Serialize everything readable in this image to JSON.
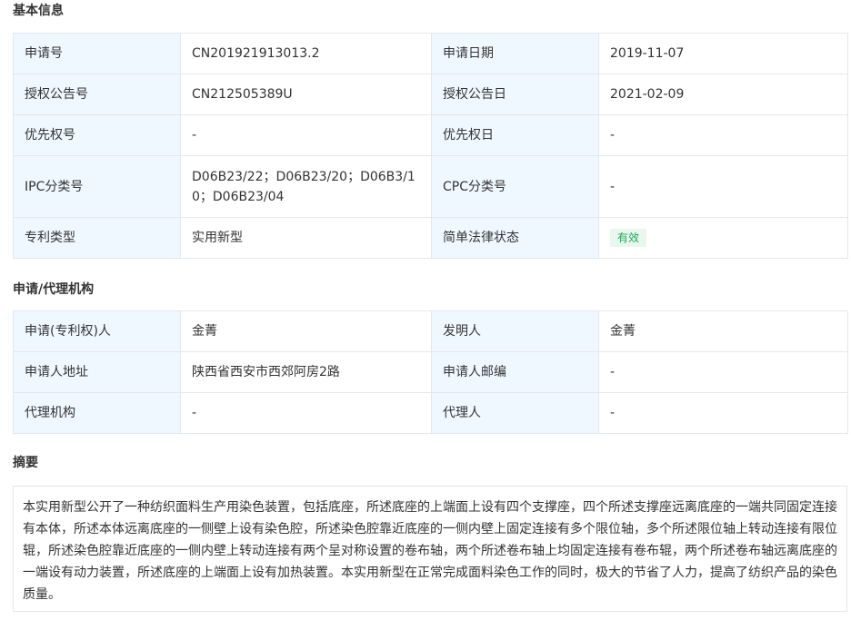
{
  "sections": {
    "basic_title": "基本信息",
    "agency_title": "申请/代理机构",
    "abstract_title": "摘要"
  },
  "basic": [
    {
      "l1": "申请号",
      "v1": "CN201921913013.2",
      "l2": "申请日期",
      "v2": "2019-11-07"
    },
    {
      "l1": "授权公告号",
      "v1": "CN212505389U",
      "l2": "授权公告日",
      "v2": "2021-02-09"
    },
    {
      "l1": "优先权号",
      "v1": "-",
      "l2": "优先权日",
      "v2": "-"
    },
    {
      "l1": "IPC分类号",
      "v1": "D06B23/22；D06B23/20；D06B3/10；D06B23/04",
      "l2": "CPC分类号",
      "v2": "-"
    },
    {
      "l1": "专利类型",
      "v1": "实用新型",
      "l2": "简单法律状态",
      "v2": "有效"
    }
  ],
  "agency": [
    {
      "l1": "申请(专利权)人",
      "v1": "金菁",
      "l2": "发明人",
      "v2": "金菁"
    },
    {
      "l1": "申请人地址",
      "v1": "陕西省西安市西郊阿房2路",
      "l2": "申请人邮编",
      "v2": "-"
    },
    {
      "l1": "代理机构",
      "v1": "-",
      "l2": "代理人",
      "v2": "-"
    }
  ],
  "abstract": "本实用新型公开了一种纺织面料生产用染色装置，包括底座，所述底座的上端面上设有四个支撑座，四个所述支撑座远离底座的一端共同固定连接有本体，所述本体远离底座的一侧壁上设有染色腔，所述染色腔靠近底座的一侧内壁上固定连接有多个限位轴，多个所述限位轴上转动连接有限位辊，所述染色腔靠近底座的一侧内壁上转动连接有两个呈对称设置的卷布轴，两个所述卷布轴上均固定连接有卷布辊，两个所述卷布轴远离底座的一端设有动力装置，所述底座的上端面上设有加热装置。本实用新型在正常完成面料染色工作的同时，极大的节省了人力，提高了纺织产品的染色质量。",
  "colors": {
    "label_bg": "#f0f8ff",
    "border": "#e4e7ed",
    "status_badge_bg": "#e8f8ef",
    "status_badge_text": "#22a55a"
  }
}
